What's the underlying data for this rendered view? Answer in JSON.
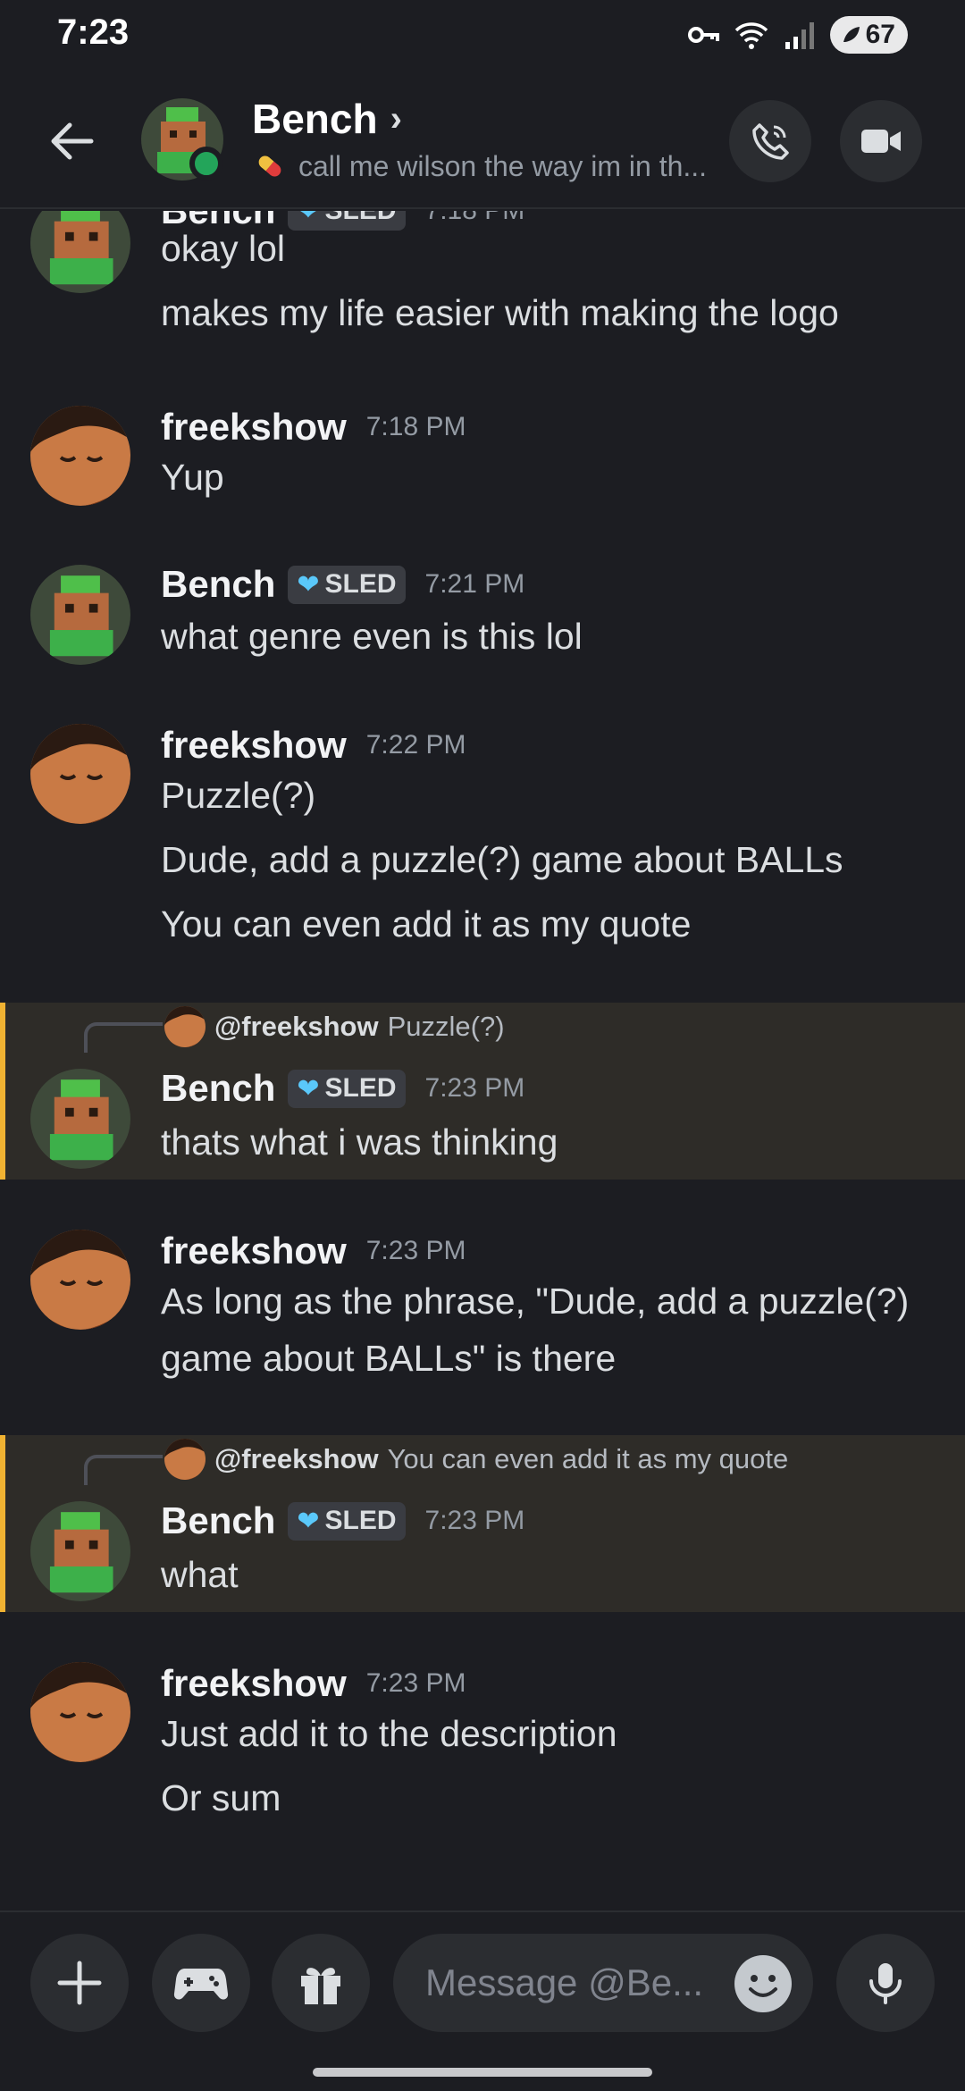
{
  "status_bar": {
    "time": "7:23",
    "battery": "67"
  },
  "header": {
    "name": "Bench",
    "chevron": "›",
    "status_text": "call me wilson the way im in th...",
    "icons": [
      "back-arrow-icon",
      "phone-icon",
      "video-camera-icon"
    ]
  },
  "colors": {
    "background": "#1c1d22",
    "online": "#23a55a",
    "highlight_bar": "#f0b232",
    "tag_heart": "#5ac8fa"
  },
  "messages": [
    {
      "author": "Bench",
      "tag": "SLED",
      "time": "7:18 PM",
      "lines": [
        "okay lol",
        "makes my life easier with making the logo"
      ]
    },
    {
      "author": "freekshow",
      "time": "7:18 PM",
      "lines": [
        "Yup"
      ]
    },
    {
      "author": "Bench",
      "tag": "SLED",
      "time": "7:21 PM",
      "lines": [
        "what genre even is this lol"
      ]
    },
    {
      "author": "freekshow",
      "time": "7:22 PM",
      "lines": [
        "Puzzle(?)",
        "Dude, add a puzzle(?) game about BALLs",
        "You can even add it as my quote"
      ]
    },
    {
      "reply_to": "@freekshow",
      "reply_text": "Puzzle(?)",
      "author": "Bench",
      "tag": "SLED",
      "time": "7:23 PM",
      "lines": [
        "thats what i was thinking"
      ]
    },
    {
      "author": "freekshow",
      "time": "7:23 PM",
      "lines": [
        "As long as the phrase, \"Dude, add a puzzle(?) game about BALLs\" is there"
      ]
    },
    {
      "reply_to": "@freekshow",
      "reply_text": "You can even add it as my quote",
      "author": "Bench",
      "tag": "SLED",
      "time": "7:23 PM",
      "lines": [
        "what"
      ]
    },
    {
      "author": "freekshow",
      "time": "7:23 PM",
      "lines": [
        "Just add it to the description",
        "Or sum"
      ]
    }
  ],
  "input": {
    "placeholder": "Message @Be...",
    "icons": [
      "plus-icon",
      "gamepad-icon",
      "gift-icon",
      "emoji-icon",
      "microphone-icon"
    ]
  }
}
